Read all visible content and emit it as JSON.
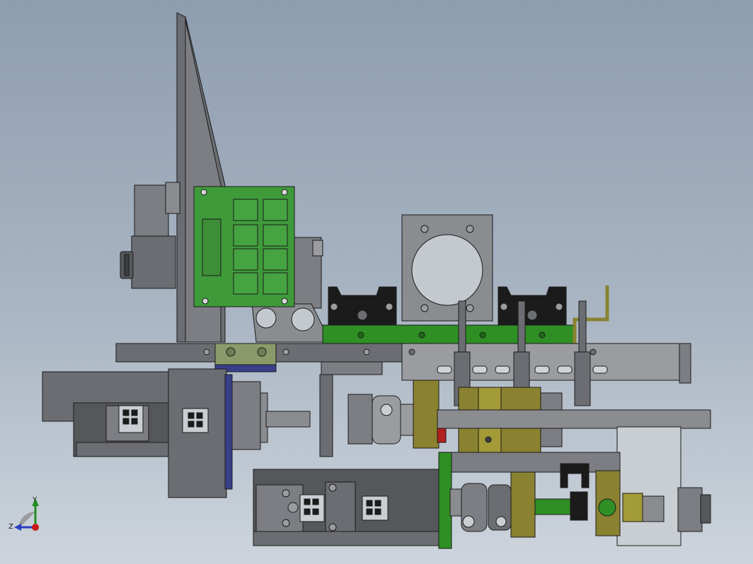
{
  "viewport": {
    "background_top": "#8e9db0",
    "background_bottom": "#cdd4dc"
  },
  "colors": {
    "frame_gray": "#6b6d72",
    "frame_light": "#8a8c90",
    "pcb_green": "#3f9a3a",
    "rail_green": "#2f8f24",
    "olive": "#8a8230",
    "bracket_gray": "#9a9c9f",
    "navy_edge": "#3a3f8a",
    "motor_dark": "#55575b",
    "plate_light": "#c9ced3",
    "black": "#1b1b1b"
  },
  "triad": {
    "y_label": "Y",
    "z_label": "Z",
    "y_color": "#1f8f1f",
    "z_color": "#2a3fbf",
    "x_color": "#c81c1c"
  },
  "parts": {
    "pcb_label": "",
    "connector_icon": "connector-icon"
  }
}
